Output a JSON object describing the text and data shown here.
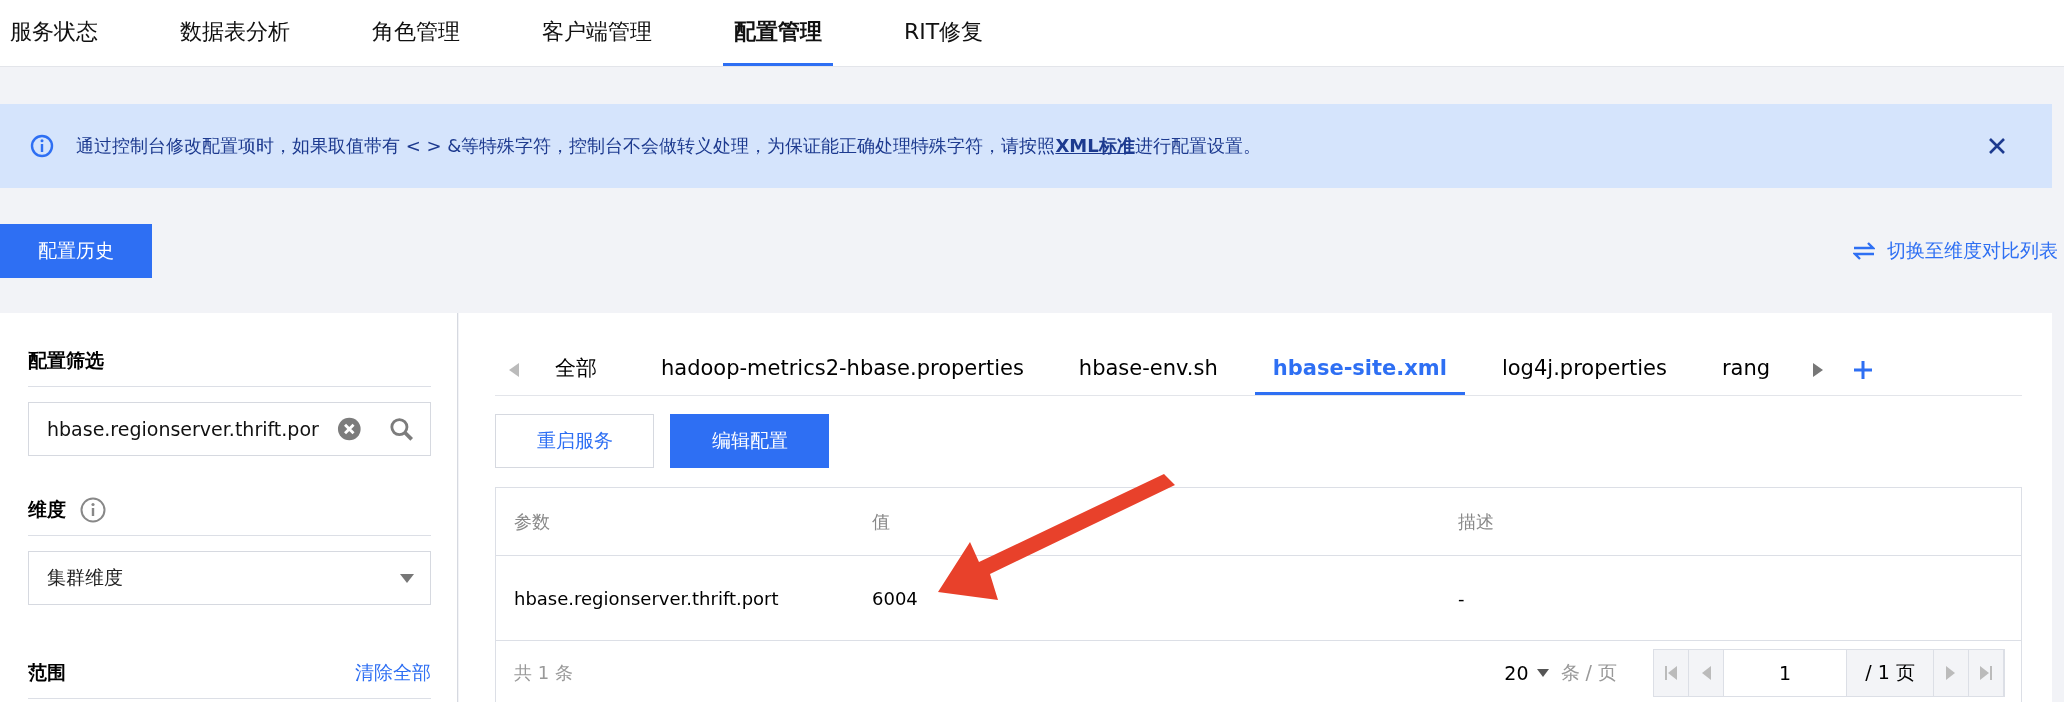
{
  "top_tabs": [
    {
      "label": "服务状态",
      "selected": false
    },
    {
      "label": "数据表分析",
      "selected": false
    },
    {
      "label": "角色管理",
      "selected": false
    },
    {
      "label": "客户端管理",
      "selected": false
    },
    {
      "label": "配置管理",
      "selected": true
    },
    {
      "label": "RIT修复",
      "selected": false
    }
  ],
  "notice": {
    "text": "通过控制台修改配置项时，如果取值带有 < > &等特殊字符，控制台不会做转义处理，为保证能正确处理特殊字符，请按照",
    "link": "XML标准",
    "text_after": "进行配置设置。"
  },
  "history_button": "配置历史",
  "switch_link": "切换至维度对比列表",
  "filter": {
    "title": "配置筛选",
    "value": "hbase.regionserver.thrift.por"
  },
  "dimension": {
    "title": "维度",
    "value": "集群维度"
  },
  "scope": {
    "title": "范围",
    "clear_link": "清除全部"
  },
  "file_tabs": [
    {
      "label": "全部",
      "selected": false
    },
    {
      "label": "hadoop-metrics2-hbase.properties",
      "selected": false
    },
    {
      "label": "hbase-env.sh",
      "selected": false
    },
    {
      "label": "hbase-site.xml",
      "selected": true
    },
    {
      "label": "log4j.properties",
      "selected": false
    },
    {
      "label": "rang",
      "selected": false
    }
  ],
  "action_buttons": [
    {
      "label": "重启服务",
      "kind": "secondary"
    },
    {
      "label": "编辑配置",
      "kind": "primary"
    }
  ],
  "table": {
    "columns": [
      "参数",
      "值",
      "描述"
    ],
    "rows": [
      [
        "hbase.regionserver.thrift.port",
        "6004",
        "-"
      ]
    ]
  },
  "footer": {
    "total": "共 1 条",
    "page_size": "20",
    "page_size_unit": "条 / 页",
    "page": "1",
    "page_total": "/ 1 页"
  }
}
